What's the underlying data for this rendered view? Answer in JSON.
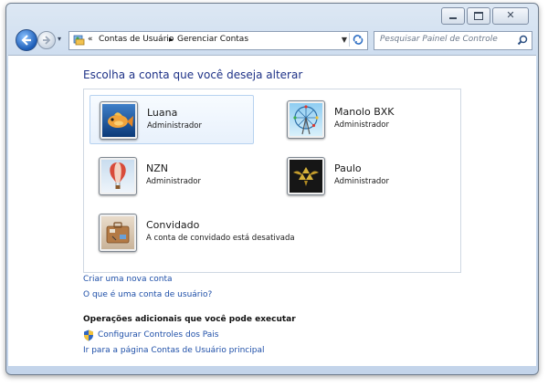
{
  "window": {
    "caption_buttons": [
      "minimize",
      "maximize",
      "close"
    ],
    "close_glyph": "✕"
  },
  "nav": {
    "history_glyph": "▾",
    "breadcrumbs": [
      "Contas de Usuário",
      "Gerenciar Contas"
    ],
    "breadcrumb_prefix": "«",
    "separator": "▶",
    "search_placeholder": "Pesquisar Painel de Controle"
  },
  "main": {
    "heading": "Escolha a conta que você deseja alterar",
    "accounts": [
      {
        "name": "Luana",
        "role": "Administrador",
        "selected": true,
        "icon": "fish-avatar-icon"
      },
      {
        "name": "Manolo BXK",
        "role": "Administrador",
        "selected": false,
        "icon": "ferris-wheel-avatar-icon"
      },
      {
        "name": "NZN",
        "role": "Administrador",
        "selected": false,
        "icon": "hot-air-balloon-avatar-icon"
      },
      {
        "name": "Paulo",
        "role": "Administrador",
        "selected": false,
        "icon": "triforce-avatar-icon"
      },
      {
        "name": "Convidado",
        "role": "A conta de convidado está desativada",
        "selected": false,
        "icon": "guest-suitcase-avatar-icon"
      }
    ],
    "links": {
      "create_account": "Criar uma nova conta",
      "what_is_account": "O que é uma conta de usuário?"
    },
    "additional_title": "Operações adicionais que você pode executar",
    "parental_controls": "Configurar Controles dos Pais",
    "main_page": "Ir para a página Contas de Usuário principal"
  },
  "colors": {
    "link": "#1e4fa8",
    "heading": "#1e3287",
    "window_frame": "#c3d4ea"
  }
}
